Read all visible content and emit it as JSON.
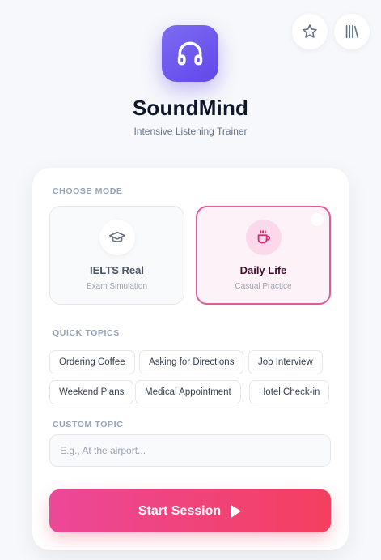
{
  "header": {
    "app_name": "SoundMind",
    "tagline": "Intensive Listening Trainer",
    "logo_icon": "headphones-icon",
    "actions": [
      {
        "icon": "star-icon"
      },
      {
        "icon": "library-icon"
      }
    ]
  },
  "mode_section": {
    "label": "CHOOSE MODE",
    "modes": [
      {
        "title": "IELTS Real",
        "subtitle": "Exam Simulation",
        "icon": "graduation-cap-icon",
        "selected": false
      },
      {
        "title": "Daily Life",
        "subtitle": "Casual Practice",
        "icon": "coffee-cup-icon",
        "selected": true
      }
    ]
  },
  "quick_topics": {
    "label": "QUICK TOPICS",
    "topics": [
      "Ordering Coffee",
      "Asking for Directions",
      "Job Interview",
      "Weekend Plans",
      "Medical Appointment",
      "Hotel Check-in"
    ]
  },
  "custom_topic": {
    "label": "CUSTOM TOPIC",
    "placeholder": "E.g., At the airport...",
    "value": ""
  },
  "start_button": {
    "label": "Start Session",
    "icon": "play-icon"
  },
  "colors": {
    "accent_pink": "#ec4899",
    "accent_red": "#f43f5e",
    "brand_purple": "#6246ea",
    "selected_border": "#e05aa0"
  }
}
